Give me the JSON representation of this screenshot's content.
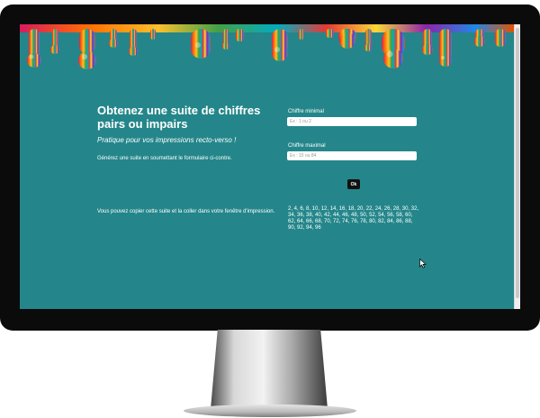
{
  "page": {
    "title": "Obtenez une suite de chiffres pairs ou impairs",
    "subtitle": "Pratique pour vos impressions recto-verso !",
    "description": "Générez une suite en soumettant le formulaire ci-contre.",
    "note": "Vous pouvez copier cette suite et la coller dans votre fenêtre d'impression."
  },
  "form": {
    "min_label": "Chiffre minimal",
    "min_placeholder": "Ex : 1 ou 2",
    "max_label": "Chiffre maximal",
    "max_placeholder": "Ex : 15 ou 84",
    "submit_label": "Ok"
  },
  "result": {
    "sequence": "2, 4, 6, 8, 10, 12, 14, 16, 18, 20, 22, 24, 26, 28, 30, 32, 34, 36, 38, 40, 42, 44, 46, 48, 50, 52, 54, 56, 58, 60, 62, 64, 66, 68, 70, 72, 74, 76, 78, 80, 82, 84, 86, 88, 90, 92, 94, 96"
  },
  "colors": {
    "background": "#24868a",
    "text": "#ffffff",
    "button": "#111111"
  }
}
